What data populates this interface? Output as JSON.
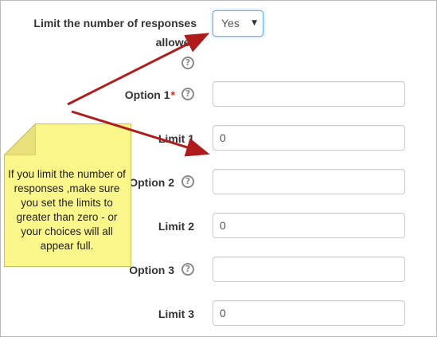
{
  "form": {
    "limit_responses": {
      "label_line1": "Limit the number of responses",
      "label_line2": "allowed",
      "selected": "Yes",
      "caret": "▼"
    },
    "option1": {
      "label": "Option 1",
      "required_mark": "*",
      "value": ""
    },
    "limit1": {
      "label": "Limit 1",
      "value": "0"
    },
    "option2": {
      "label": "Option 2",
      "value": ""
    },
    "limit2": {
      "label": "Limit 2",
      "value": "0"
    },
    "option3": {
      "label": "Option 3",
      "value": ""
    },
    "limit3": {
      "label": "Limit 3",
      "value": "0"
    },
    "help_glyph": "?"
  },
  "annotation": {
    "text": "If you limit the number of responses ,make sure you set the limits to greater than zero - or your choices will all appear full."
  },
  "colors": {
    "note_background": "#fbf68a",
    "arrow": "#b01c1c",
    "required": "#c9302c",
    "focus_border": "#66afe9"
  }
}
